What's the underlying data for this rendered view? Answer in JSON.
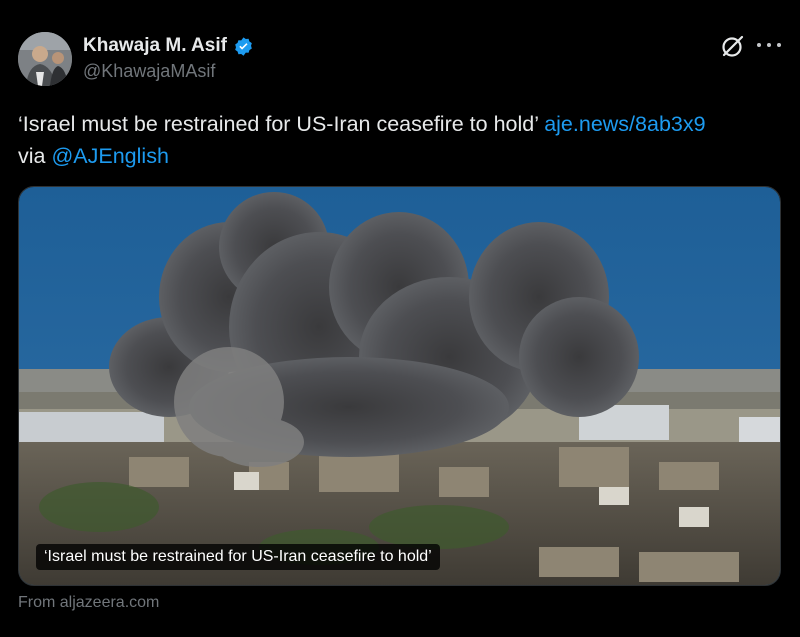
{
  "author": {
    "name": "Khawaja M. Asif",
    "handle": "@KhawajaMAsif",
    "verified": true
  },
  "tweet": {
    "text": "‘Israel must be restrained for US-Iran ceasefire to hold’",
    "link": "aje.news/8ab3x9",
    "via": "via",
    "mention": "@AJEnglish"
  },
  "media": {
    "caption": "‘Israel must be restrained for US-Iran ceasefire to hold’",
    "source": "From aljazeera.com"
  },
  "icons": {
    "grok": "grok-icon",
    "more": "more-options-icon",
    "verified": "verified-badge-icon"
  },
  "colors": {
    "background": "#000000",
    "text": "#e7e9ea",
    "secondary": "#71767b",
    "link": "#1d9bf0"
  }
}
